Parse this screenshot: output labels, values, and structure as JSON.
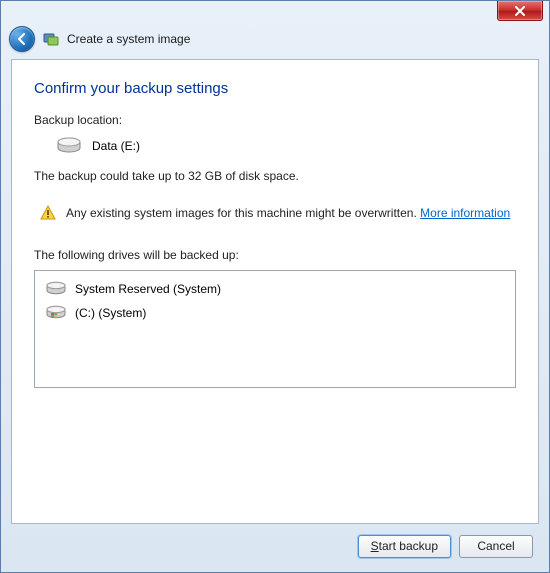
{
  "window": {
    "title": "Create a system image"
  },
  "page": {
    "heading": "Confirm your backup settings",
    "backup_location_label": "Backup location:",
    "backup_location_value": "Data (E:)",
    "backup_size_note": "The backup could take up to 32 GB of disk space.",
    "warning_text": "Any existing system images for this machine might be overwritten.",
    "more_info_link": "More information",
    "drives_label": "The following drives will be backed up:",
    "drives": [
      {
        "name": "System Reserved (System)",
        "icon": "drive-plain"
      },
      {
        "name": "(C:) (System)",
        "icon": "drive-windows"
      }
    ]
  },
  "footer": {
    "start_backup_label": "Start backup",
    "cancel_label": "Cancel"
  }
}
